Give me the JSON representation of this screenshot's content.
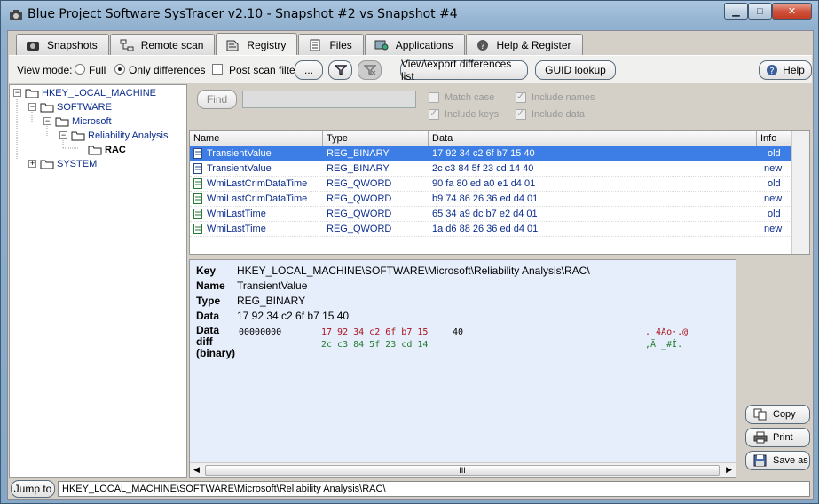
{
  "window": {
    "title": "Blue Project Software SysTracer v2.10 - Snapshot #2 vs Snapshot #4"
  },
  "tabs": [
    {
      "label": "Snapshots",
      "icon": "camera-icon"
    },
    {
      "label": "Remote scan",
      "icon": "network-icon"
    },
    {
      "label": "Registry",
      "icon": "registry-icon",
      "active": true
    },
    {
      "label": "Files",
      "icon": "files-icon"
    },
    {
      "label": "Applications",
      "icon": "applications-icon"
    },
    {
      "label": "Help & Register",
      "icon": "help-icon"
    }
  ],
  "toolbar": {
    "view_mode_label": "View mode:",
    "full_label": "Full",
    "only_diff_label": "Only differences",
    "post_scan_label": "Post scan filter",
    "dots_label": "...",
    "view_export_label": "View\\export differences list",
    "guid_label": "GUID lookup",
    "help_label": "Help"
  },
  "tree": [
    {
      "label": "HKEY_LOCAL_MACHINE",
      "expanded": true
    },
    {
      "label": "SOFTWARE",
      "expanded": true
    },
    {
      "label": "Microsoft",
      "expanded": true
    },
    {
      "label": "Reliability Analysis",
      "expanded": true
    },
    {
      "label": "RAC",
      "selected": true
    },
    {
      "label": "SYSTEM",
      "expanded": false
    }
  ],
  "search": {
    "find_label": "Find",
    "match_case": "Match case",
    "include_names": "Include names",
    "include_keys": "Include keys",
    "include_data": "Include data"
  },
  "grid": {
    "columns": [
      "Name",
      "Type",
      "Data",
      "Info"
    ],
    "rows": [
      {
        "name": "TransientValue",
        "type": "REG_BINARY",
        "data": "17 92 34 c2 6f b7 15 40",
        "info": "old",
        "selected": true
      },
      {
        "name": "TransientValue",
        "type": "REG_BINARY",
        "data": "2c c3 84 5f 23 cd 14 40",
        "info": "new"
      },
      {
        "name": "WmiLastCrimDataTime",
        "type": "REG_QWORD",
        "data": "90 fa 80 ed a0 e1 d4 01",
        "info": "old"
      },
      {
        "name": "WmiLastCrimDataTime",
        "type": "REG_QWORD",
        "data": "b9 74 86 26 36 ed d4 01",
        "info": "new"
      },
      {
        "name": "WmiLastTime",
        "type": "REG_QWORD",
        "data": "65 34 a9 dc b7 e2 d4 01",
        "info": "old"
      },
      {
        "name": "WmiLastTime",
        "type": "REG_QWORD",
        "data": "1a d6 88 26 36 ed d4 01",
        "info": "new"
      }
    ]
  },
  "detail": {
    "key_label": "Key",
    "key_value": "HKEY_LOCAL_MACHINE\\SOFTWARE\\Microsoft\\Reliability Analysis\\RAC\\",
    "name_label": "Name",
    "name_value": "TransientValue",
    "type_label": "Type",
    "type_value": "REG_BINARY",
    "data_label": "Data",
    "data_value": "17 92 34 c2 6f b7 15 40",
    "diff_label_1": "Data",
    "diff_label_2": "diff",
    "diff_label_3": "(binary)",
    "offset": "00000000",
    "old_changed": "17 92 34 c2 6f b7 15",
    "old_same": "40",
    "new_changed": "2c c3 84 5f 23 cd 14",
    "old_ascii": ". 4Âo·.@",
    "new_ascii": ",Ã _#Í.",
    "scroll_grip": "III"
  },
  "side_buttons": {
    "copy": "Copy",
    "print": "Print",
    "save_as": "Save as"
  },
  "bottom": {
    "jump_label": "Jump to",
    "path": "HKEY_LOCAL_MACHINE\\SOFTWARE\\Microsoft\\Reliability Analysis\\RAC\\"
  },
  "colors": {
    "selection": "#3d7ee6",
    "link_blue": "#0b2d8c",
    "diff_old": "#a8141e",
    "diff_new": "#1e7a2e"
  }
}
